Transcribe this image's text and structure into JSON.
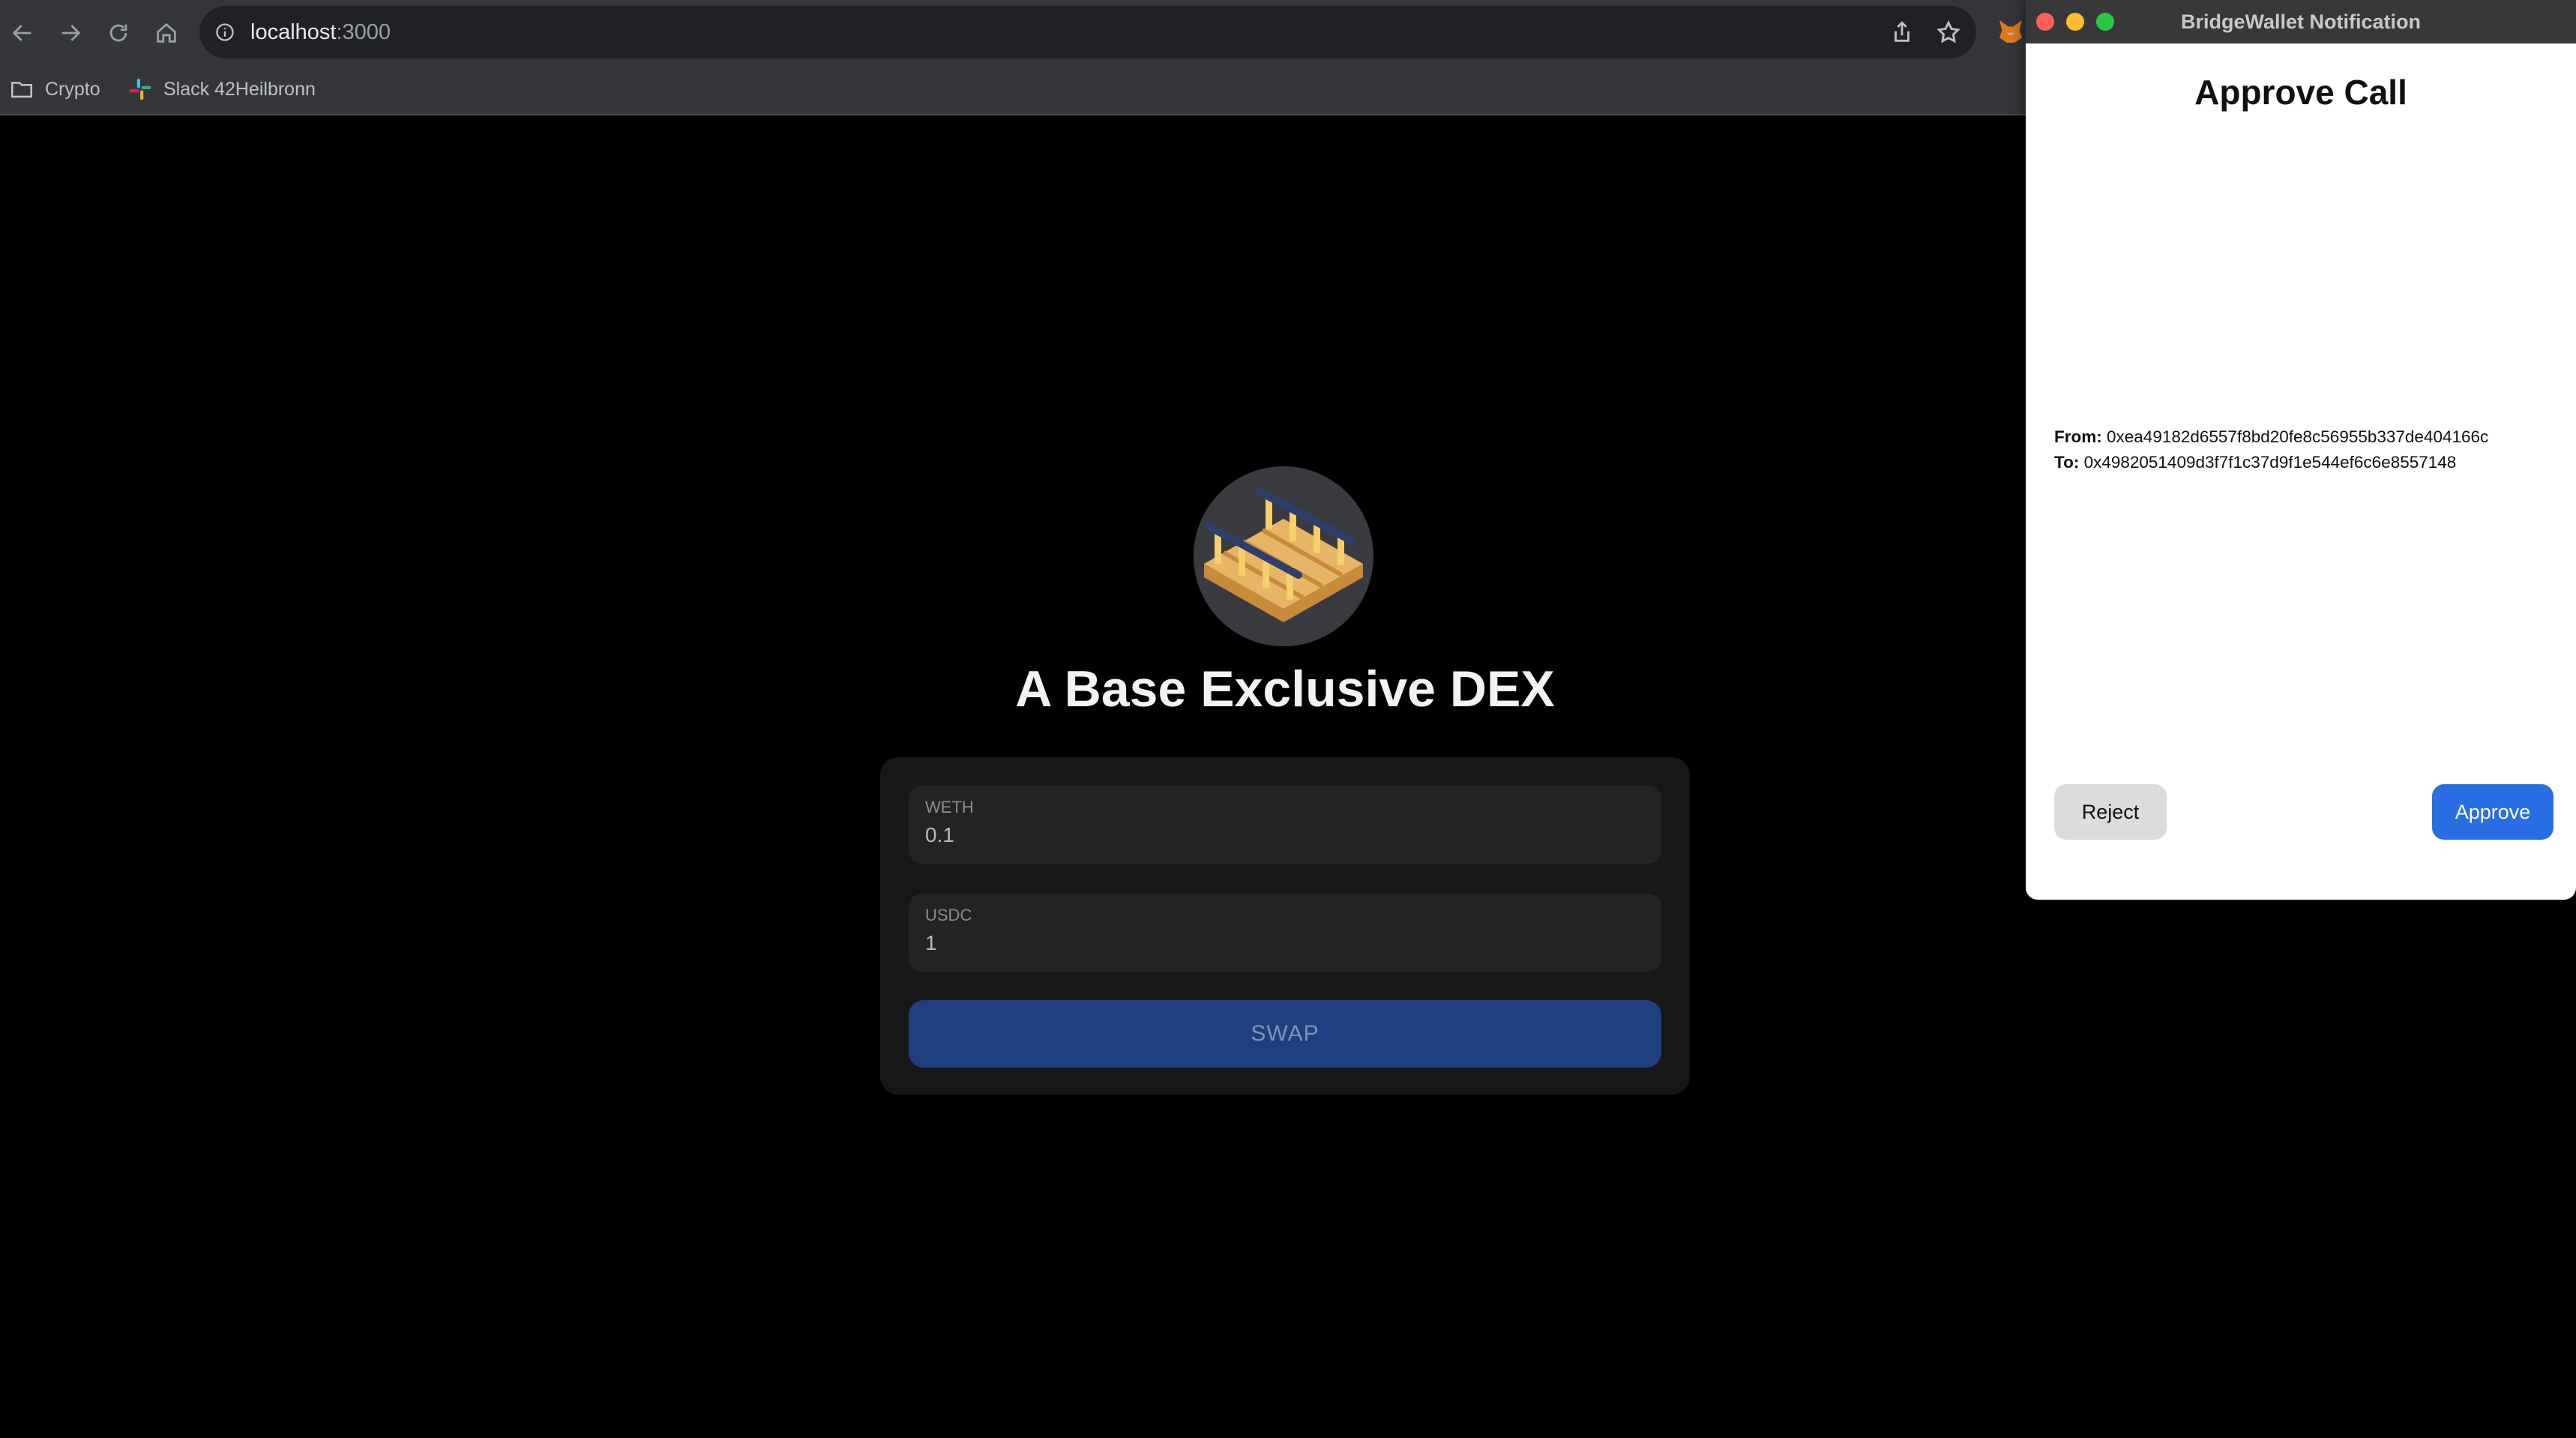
{
  "browser": {
    "url_host": "localhost",
    "url_port": ":3000",
    "bookmarks": [
      {
        "label": "Crypto",
        "icon": "folder-icon"
      },
      {
        "label": "Slack 42Heilbronn",
        "icon": "slack-icon"
      }
    ],
    "toolbar_icons": [
      "back-arrow-icon",
      "forward-arrow-icon",
      "reload-icon",
      "home-icon",
      "info-icon",
      "share-icon",
      "bookmark-star-icon",
      "metamask-fox-icon"
    ]
  },
  "page": {
    "headline": "A Base Exclusive DEX",
    "logo_icon": "bridge-logo-icon",
    "swap": {
      "from_token": "WETH",
      "from_amount": "0.1",
      "to_token": "USDC",
      "to_amount": "1",
      "button_label": "SWAP"
    }
  },
  "notification": {
    "window_title": "BridgeWallet Notification",
    "heading": "Approve Call",
    "from_label": "From:",
    "from_address": "0xea49182d6557f8bd20fe8c56955b337de404166c",
    "to_label": "To:",
    "to_address": "0x4982051409d3f7f1c37d9f1e544ef6c6e8557148",
    "reject_label": "Reject",
    "approve_label": "Approve"
  },
  "colors": {
    "page_background": "#000000",
    "card_background": "#171717",
    "swap_button": "#1f3f80",
    "approve_button": "#2a6ee5",
    "reject_button": "#dcdcde",
    "traffic_red": "#ff5f57",
    "traffic_yellow": "#febc2e",
    "traffic_green": "#28c840"
  }
}
